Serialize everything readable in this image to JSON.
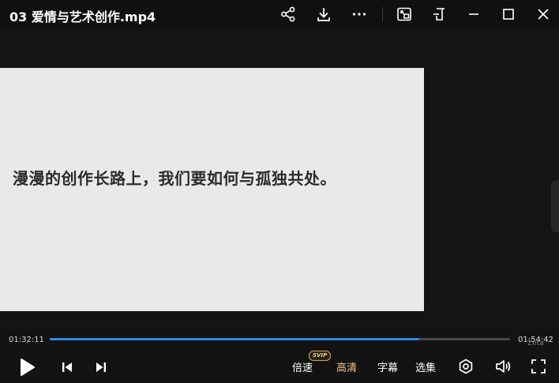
{
  "window": {
    "title": "03 爱情与艺术创作.mp4"
  },
  "titlebar_icons": [
    "share-icon",
    "download-icon",
    "more-icon",
    "pip-icon",
    "mini-mode-icon",
    "minimize-icon",
    "maximize-icon",
    "close-icon"
  ],
  "slide": {
    "text": "漫漫的创作长路上，我们要如何与孤独共处。"
  },
  "player": {
    "current_time": "01:32:11",
    "total_time": "01:54:42",
    "progress": 0.803,
    "watermark": "Zeta",
    "accent_color": "#2e8de6",
    "hd_color": "#f4c78a"
  },
  "controls": {
    "speed_label": "倍速",
    "speed_badge": "SVIP",
    "quality_label": "高清",
    "subtitle_label": "字幕",
    "episodes_label": "选集"
  }
}
